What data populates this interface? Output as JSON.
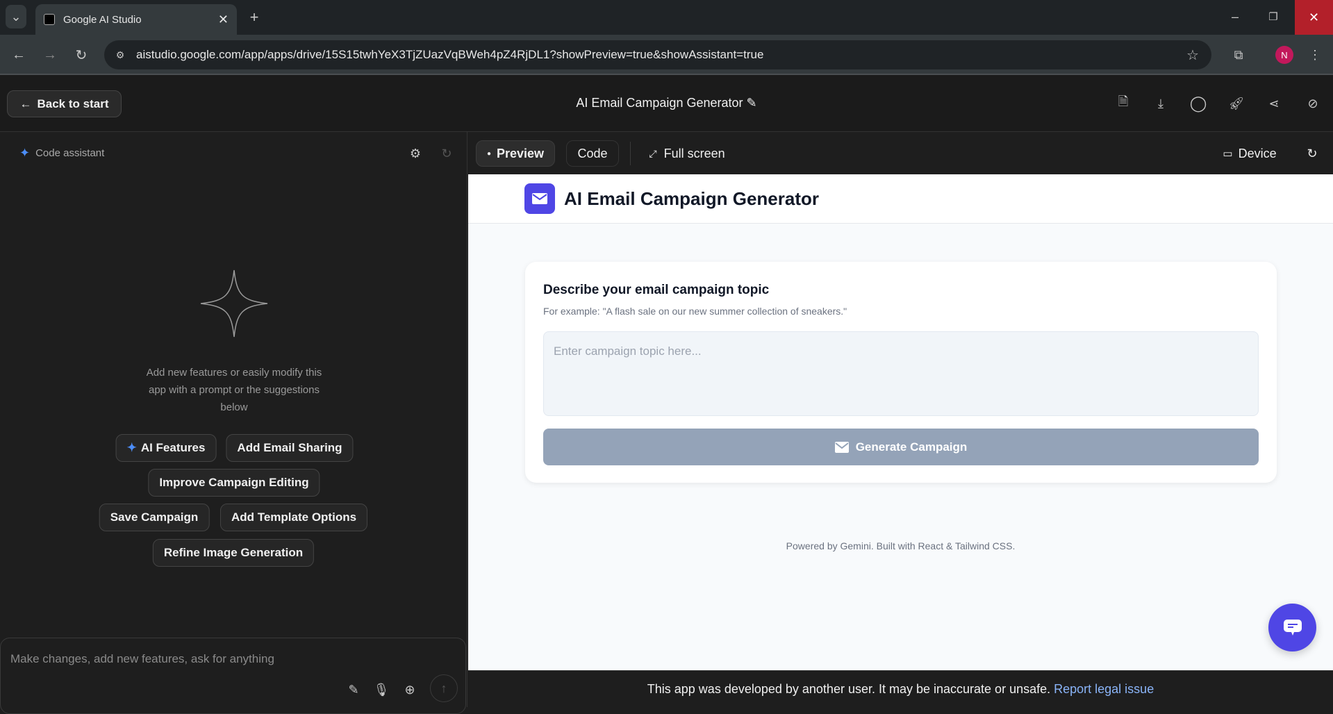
{
  "browser": {
    "tab_title": "Google AI Studio",
    "url": "aistudio.google.com/app/apps/drive/15S15twhYeX3TjZUazVqBWeh4pZ4RjDL1?showPreview=true&showAssistant=true",
    "profile_initial": "N"
  },
  "header": {
    "back_label": "Back to start",
    "title": "AI Email Campaign Generator"
  },
  "assistant": {
    "label": "Code assistant",
    "hint": "Add new features or easily modify this app with a prompt or the suggestions below",
    "chips": [
      "AI Features",
      "Add Email Sharing",
      "Improve Campaign Editing",
      "Save Campaign",
      "Add Template Options",
      "Refine Image Generation"
    ],
    "input_placeholder": "Make changes, add new features, ask for anything"
  },
  "toolbar": {
    "preview": "Preview",
    "code": "Code",
    "fullscreen": "Full screen",
    "device": "Device"
  },
  "app": {
    "title": "AI Email Campaign Generator",
    "card_title": "Describe your email campaign topic",
    "card_hint": "For example: \"A flash sale on our new summer collection of sneakers.\"",
    "textarea_placeholder": "Enter campaign topic here...",
    "generate_label": "Generate Campaign",
    "footer": "Powered by Gemini. Built with React & Tailwind CSS.",
    "accent": "#4f46e5",
    "button_color": "#94a3b8"
  },
  "notice": {
    "text": "This app was developed by another user. It may be inaccurate or unsafe.",
    "link": "Report legal issue"
  }
}
